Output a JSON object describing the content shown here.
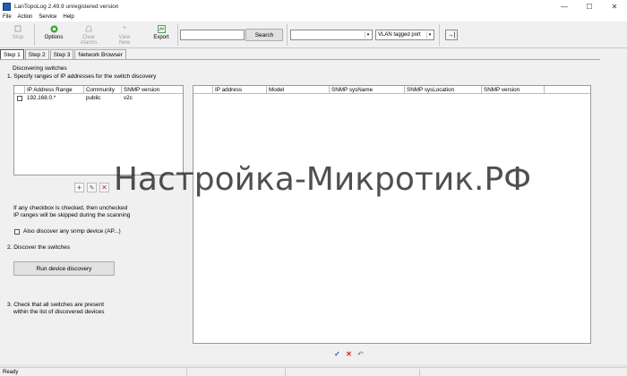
{
  "window": {
    "title": "LanTopoLog 2.49.9 unregistered version",
    "controls": {
      "minimize": "—",
      "maximize": "☐",
      "close": "✕"
    }
  },
  "menu": [
    "File",
    "Action",
    "Service",
    "Help"
  ],
  "toolbar": {
    "stop": "Stop",
    "options": "Options",
    "clear_alarms": "Clear Alarms",
    "view_new": "View New",
    "export": "Export",
    "search_value": "",
    "search_button": "Search",
    "filter_select": "",
    "vlan_select": "VLAN tagged port",
    "exit_icon": "→|"
  },
  "tabs": [
    "Step 1",
    "Step 2",
    "Step 3",
    "Network Browser"
  ],
  "step1": {
    "heading": "Discovering switches",
    "instruction1": "1. Specify ranges of IP addresses for the switch discovery",
    "ranges_table": {
      "columns": [
        "IP Address Range",
        "Community",
        "SNMP version"
      ],
      "rows": [
        [
          "192.168.0.*",
          "public",
          "v2c"
        ]
      ]
    },
    "note_line1": "If any checkbox is checked, then unchecked",
    "note_line2": "IP ranges will be skipped during the scanning",
    "also_discover": "Also discover any snmp device (AP...)",
    "instruction2": "2. Discover the switches",
    "run_button": "Run device discovery",
    "instruction3_line1": "3. Check that all switches are present",
    "instruction3_line2": "within the list of discovered devices"
  },
  "devices_table": {
    "columns": [
      "IP address",
      "Model",
      "SNMP sysName",
      "SNMP sysLocation",
      "SNMP version"
    ]
  },
  "status": "Ready",
  "watermark": "Настройка-Микротик.РФ",
  "colors": {
    "accent": "#1e5fb4",
    "add_green": "#2e9a2e",
    "delete_red": "#cc2222"
  }
}
